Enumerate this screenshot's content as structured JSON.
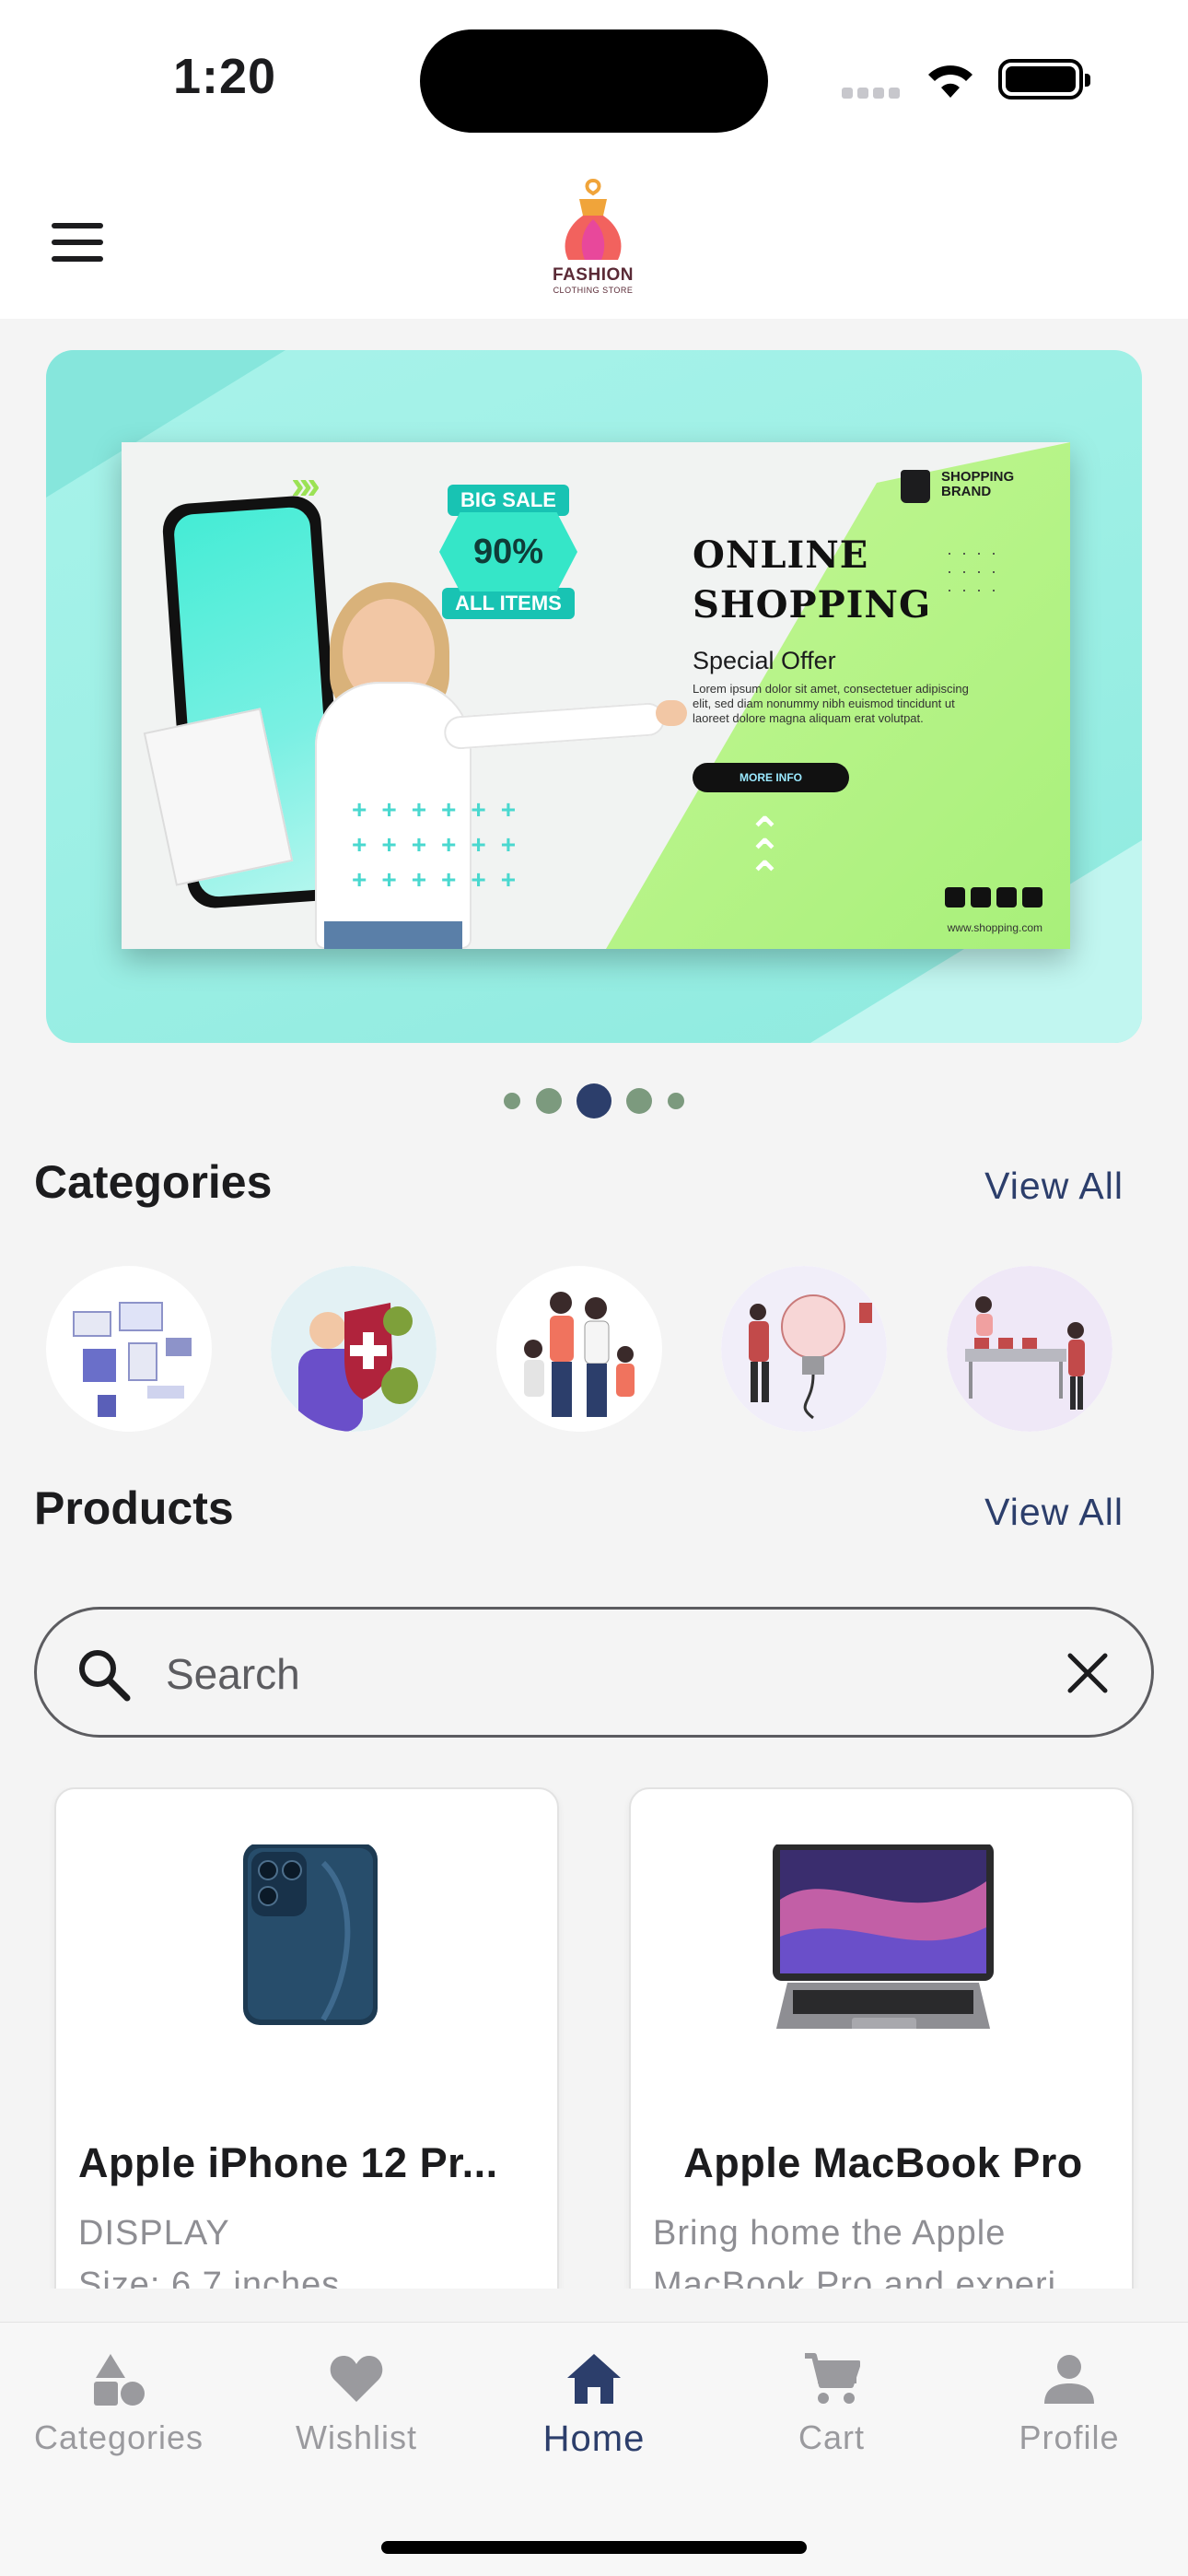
{
  "status_bar": {
    "time": "1:20"
  },
  "header": {
    "logo_title": "FASHION",
    "logo_subtitle": "CLOTHING STORE"
  },
  "banner": {
    "badge_top": "BIG SALE",
    "badge_mid": "90% OFF",
    "badge_bottom": "ALL ITEMS",
    "brand": "SHOPPING BRAND",
    "title_line1": "ONLINE",
    "title_line2": "SHOPPING",
    "offer": "Special Offer",
    "body": "Lorem ipsum dolor sit amet, consectetuer adipiscing elit, sed diam nonummy nibh euismod tincidunt ut laoreet dolore magna aliquam erat volutpat.",
    "cta": "MORE INFO",
    "url": "www.shopping.com",
    "page_count": 5,
    "active_page": 3
  },
  "categories": {
    "title": "Categories",
    "view_all": "View All",
    "items": [
      {
        "icon": "devices-illustration"
      },
      {
        "icon": "health-protection-illustration"
      },
      {
        "icon": "family-fashion-illustration"
      },
      {
        "icon": "lightbulb-idea-illustration"
      },
      {
        "icon": "store-shopping-illustration"
      }
    ]
  },
  "products": {
    "title": "Products",
    "view_all": "View All",
    "search_placeholder": "Search",
    "items": [
      {
        "title": "Apple iPhone 12 Pr...",
        "desc_line1": "DISPLAY",
        "desc_line2": "Size: 6.7 inches"
      },
      {
        "title": "Apple MacBook Pro",
        "desc_line1": "Bring home the Apple",
        "desc_line2": "MacBook Pro and experi..."
      }
    ]
  },
  "tabbar": {
    "tabs": [
      {
        "label": "Categories",
        "icon": "shapes-icon"
      },
      {
        "label": "Wishlist",
        "icon": "heart-icon"
      },
      {
        "label": "Home",
        "icon": "home-icon",
        "active": true
      },
      {
        "label": "Cart",
        "icon": "cart-icon"
      },
      {
        "label": "Profile",
        "icon": "person-icon"
      }
    ]
  },
  "colors": {
    "accent": "#2c3e6b",
    "inactive": "#9a9a9e",
    "dot_active": "#2c3e6b",
    "dot_inactive": "#7c9a7e",
    "banner_bg": "#9ff0e6"
  }
}
